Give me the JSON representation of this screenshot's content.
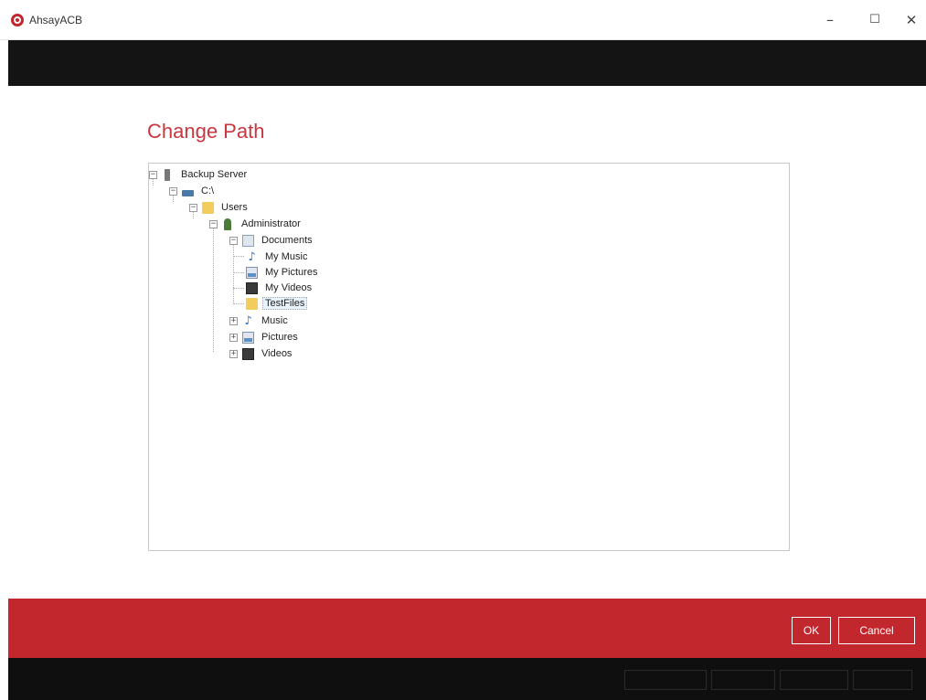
{
  "window": {
    "title": "AhsayACB",
    "minimize_glyph": "–",
    "maximize_glyph": "☐",
    "close_glyph": "✕"
  },
  "dialog": {
    "title": "Change Path"
  },
  "tree": {
    "expander_open": "−",
    "expander_closed": "+",
    "nodes": [
      {
        "label": "Backup Server",
        "icon": "server-icon"
      },
      {
        "label": "C:\\",
        "icon": "drive-icon"
      },
      {
        "label": "Users",
        "icon": "folder-icon"
      },
      {
        "label": "Administrator",
        "icon": "user-icon"
      },
      {
        "label": "Documents",
        "icon": "documents-icon"
      },
      {
        "label": "My Music",
        "icon": "music-icon"
      },
      {
        "label": "My Pictures",
        "icon": "pictures-icon"
      },
      {
        "label": "My Videos",
        "icon": "videos-icon"
      },
      {
        "label": "TestFiles",
        "icon": "folder-icon",
        "selected": true
      },
      {
        "label": "Music",
        "icon": "music-icon"
      },
      {
        "label": "Pictures",
        "icon": "pictures-icon"
      },
      {
        "label": "Videos",
        "icon": "videos-icon"
      }
    ]
  },
  "buttons": {
    "ok": "OK",
    "cancel": "Cancel"
  },
  "colors": {
    "accent": "#c1272d",
    "title_text": "#c9363e",
    "header_bar": "#141414"
  }
}
